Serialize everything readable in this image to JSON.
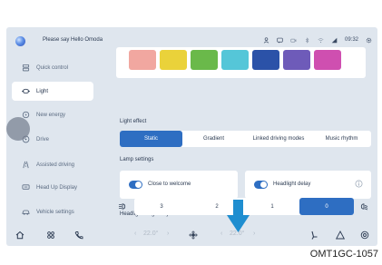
{
  "status_bar": {
    "greeting": "Please say Hello Omoda",
    "clock": "09:32"
  },
  "sidebar": {
    "items": [
      {
        "label": "Quick control",
        "icon": "quick-control-icon"
      },
      {
        "label": "Light",
        "icon": "light-icon",
        "active": true
      },
      {
        "label": "New energy",
        "icon": "new-energy-icon"
      },
      {
        "label": "Drive",
        "icon": "steering-wheel-icon"
      },
      {
        "label": "Assisted driving",
        "icon": "assisted-driving-icon"
      },
      {
        "label": "Head Up Display",
        "icon": "hud-icon"
      },
      {
        "label": "Vehicle settings",
        "icon": "vehicle-settings-icon"
      }
    ]
  },
  "ambient_swatches": [
    "#f1a7a0",
    "#ead23a",
    "#6ab94a",
    "#55c6d8",
    "#2b52a8",
    "#6e5bb9",
    "#cf4fb0"
  ],
  "light_effect": {
    "title": "Light effect",
    "options": [
      "Static",
      "Gradient",
      "Linked driving modes",
      "Music rhythm"
    ],
    "selected": "Static"
  },
  "lamp_settings": {
    "title": "Lamp settings",
    "close_to_welcome": {
      "label": "Close to welcome",
      "on": true
    },
    "headlight_delay": {
      "label": "Headlight delay",
      "on": true
    }
  },
  "headlight_height": {
    "title": "Headlight height adjustment",
    "levels": [
      "3",
      "2",
      "1",
      "0"
    ],
    "selected": "0"
  },
  "dock": {
    "left_temp": "22.0°",
    "right_temp": "22.0°",
    "left_chevron": "‹",
    "left_chevron_right": "›",
    "right_chevron": "‹",
    "right_chevron_right": "›"
  },
  "figure_code": "OMT1GC-1057",
  "colors": {
    "accent": "#2e6ec2",
    "screen_bg": "#dfe6ee",
    "arrow": "#1f8ed0"
  }
}
